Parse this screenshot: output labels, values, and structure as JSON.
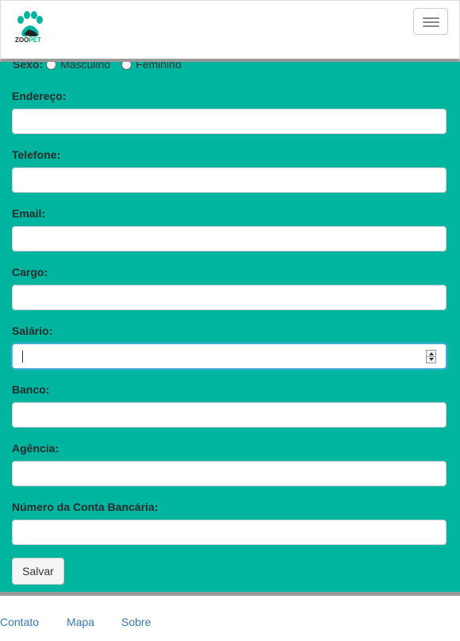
{
  "navbar": {
    "logo_text_zoo": "ZOO",
    "logo_text_pet": "PET"
  },
  "form": {
    "sexo_label": "Sexo:",
    "sexo_options": [
      "Masculino",
      "Feminino"
    ],
    "fields": [
      {
        "label": "Endereço:",
        "value": ""
      },
      {
        "label": "Telefone:",
        "value": ""
      },
      {
        "label": "Email:",
        "value": ""
      },
      {
        "label": "Cargo:",
        "value": ""
      },
      {
        "label": "Salário:",
        "value": ""
      },
      {
        "label": "Banco:",
        "value": ""
      },
      {
        "label": "Agência:",
        "value": ""
      },
      {
        "label": "Número da Conta Bancária:",
        "value": ""
      }
    ],
    "save_label": "Salvar"
  },
  "footer": {
    "links": [
      "Contato",
      "Mapa",
      "Sobre"
    ]
  },
  "colors": {
    "accent": "#00b5a0",
    "link": "#337ab7"
  }
}
